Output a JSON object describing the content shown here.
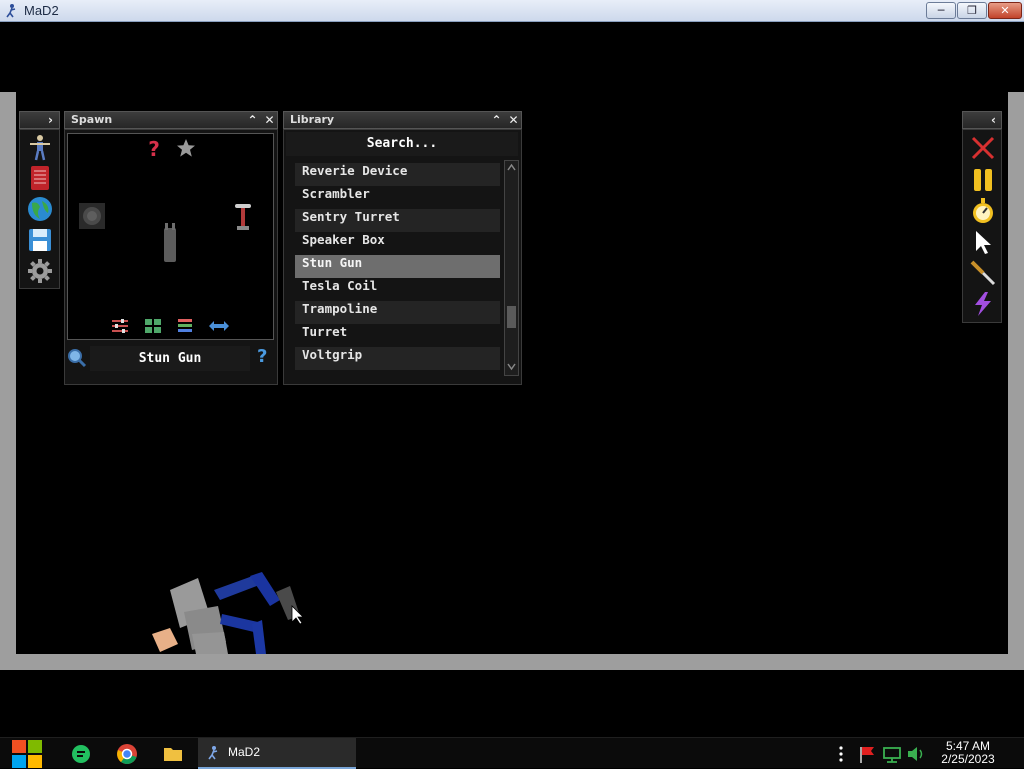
{
  "window": {
    "title": "MaD2",
    "buttons": {
      "minimize": "─",
      "maximize": "❐",
      "close": "✕"
    }
  },
  "left_toolbar": {
    "expand_glyph": "›",
    "tools": [
      "ragdoll-icon",
      "book-icon",
      "globe-icon",
      "save-icon",
      "gear-icon"
    ]
  },
  "spawn": {
    "title": "Spawn",
    "collapse_glyph": "⌃",
    "close_glyph": "✕",
    "preview_top_icons": [
      "question-icon",
      "star-icon"
    ],
    "preview_bottom_icons": [
      "sliders-icon",
      "grid-icon",
      "layers-icon",
      "swap-arrows-icon"
    ],
    "selected_item": "Stun Gun",
    "help_glyph": "?"
  },
  "library": {
    "title": "Library",
    "collapse_glyph": "⌃",
    "close_glyph": "✕",
    "search_placeholder": "Search...",
    "items": [
      "Reverie Device",
      "Scrambler",
      "Sentry Turret",
      "Speaker Box",
      "Stun Gun",
      "Tesla Coil",
      "Trampoline",
      "Turret",
      "Voltgrip"
    ],
    "selected_index": 4
  },
  "right_toolbar": {
    "collapse_glyph": "‹",
    "tools": [
      "clear-x-icon",
      "pause-icon",
      "stopwatch-icon",
      "cursor-icon",
      "knife-icon",
      "lightning-icon"
    ]
  },
  "taskbar": {
    "running_app": "MaD2",
    "time": "5:47 AM",
    "date": "2/25/2023"
  },
  "colors": {
    "selected_row": "#6e6e6e",
    "panel_bg": "#141414",
    "frame_border": "#9e9e9e"
  }
}
